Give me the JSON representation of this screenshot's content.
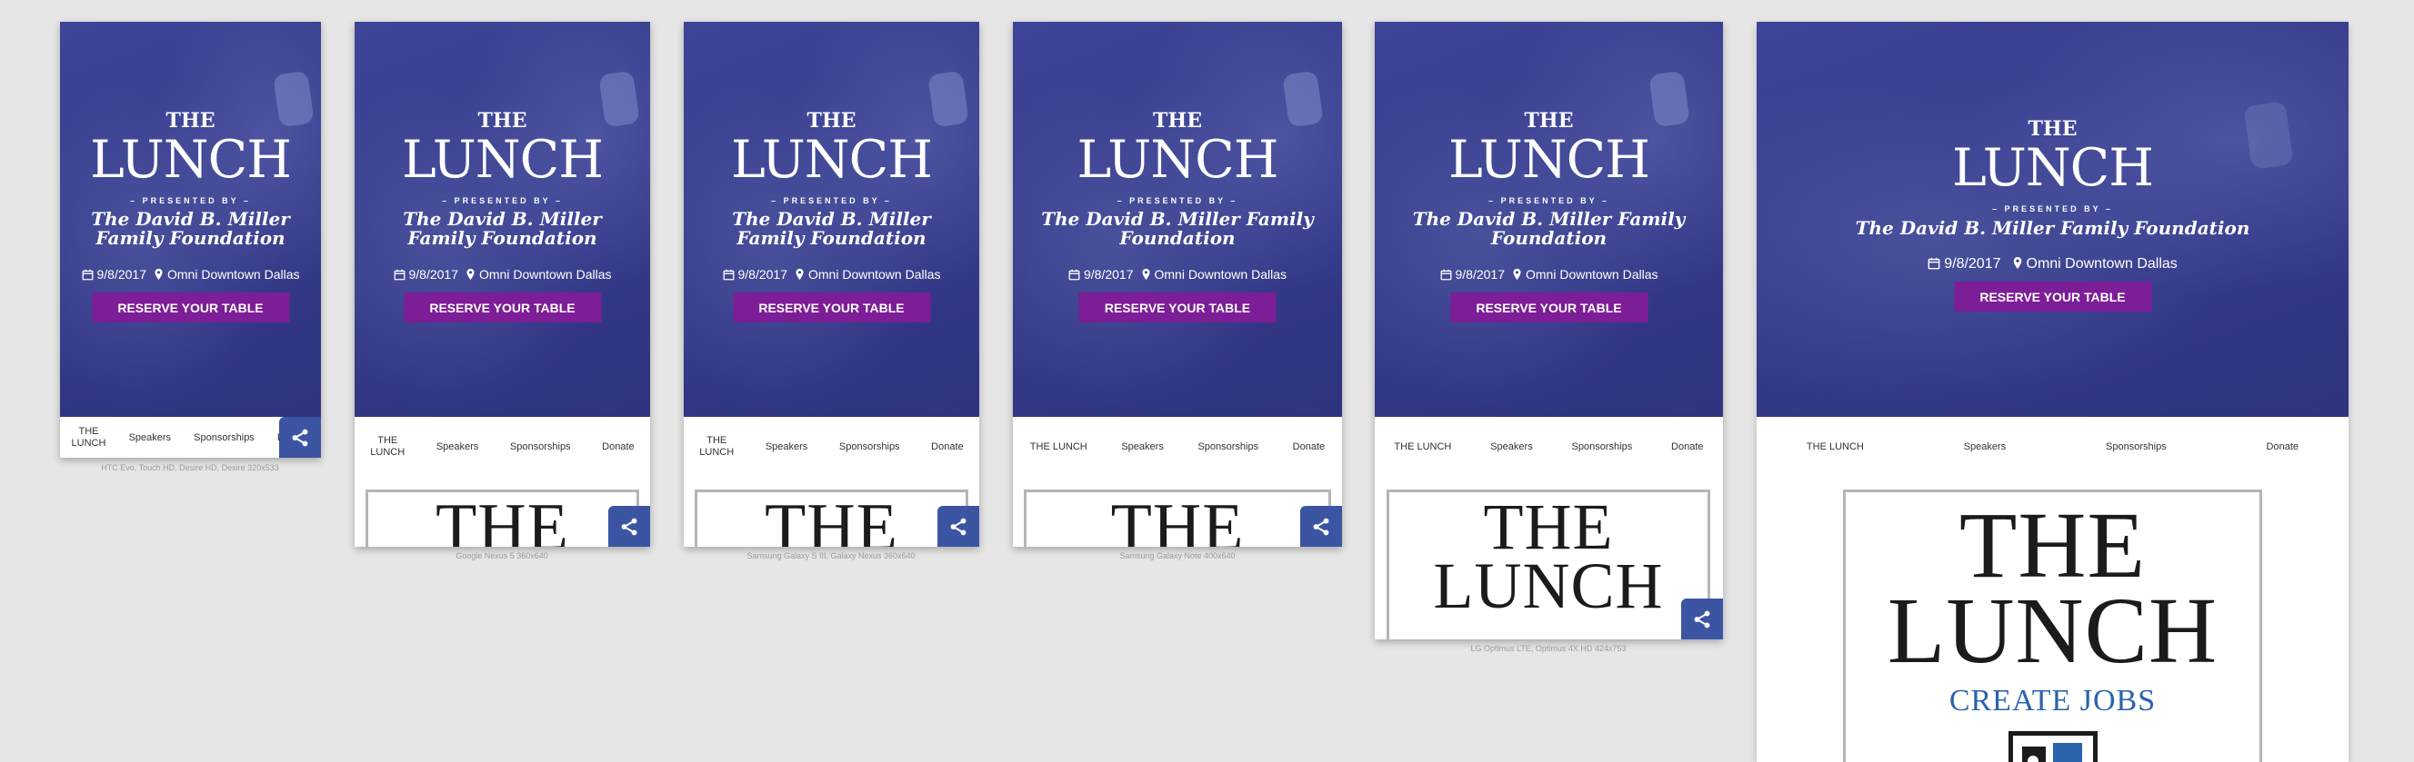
{
  "brand": {
    "accent_button": "#7d1d97",
    "hero_blue": "#353a8b",
    "share_blue": "#3b55a3"
  },
  "hero": {
    "the": "THE",
    "lunch": "LUNCH",
    "presented_by": "– PRESENTED BY –",
    "foundation": "The David B. Miller Family Foundation",
    "date": "9/8/2017",
    "venue": "Omni Downtown Dallas",
    "reserve_label": "RESERVE YOUR TABLE"
  },
  "nav": {
    "home_label": "THE LUNCH",
    "home_line1": "THE",
    "home_line2": "LUNCH",
    "speakers": "Speakers",
    "sponsorships": "Sponsorships",
    "donate": "Donate"
  },
  "logo": {
    "the": "THE",
    "lunch": "LUNCH",
    "tagline": "CREATE JOBS"
  },
  "icons": {
    "calendar": "calendar-icon",
    "location": "map-pin-icon",
    "share": "share-icon"
  },
  "devices": [
    {
      "caption": "HTC Evo, Touch HD, Desire HD, Desire   320x533"
    },
    {
      "caption": "Google Nexus 5   360x640"
    },
    {
      "caption": "Samsung Galaxy S III, Galaxy Nexus   360x640"
    },
    {
      "caption": "Samsung Galaxy Note   400x640"
    },
    {
      "caption": "LG Optimus LTE, Optimus 4X HD   424x753"
    },
    {
      "caption": ""
    }
  ]
}
